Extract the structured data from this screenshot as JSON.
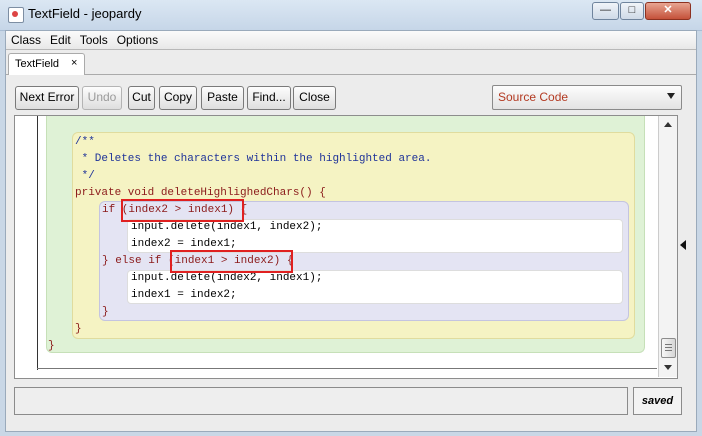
{
  "window": {
    "title": "TextField - jeopardy",
    "min_glyph": "—",
    "max_glyph": "□",
    "close_glyph": "✕"
  },
  "menu": {
    "items": [
      "Class",
      "Edit",
      "Tools",
      "Options"
    ]
  },
  "tabs": [
    {
      "label": "TextField",
      "close": "×"
    }
  ],
  "toolbar": {
    "buttons": [
      {
        "label": "Next Error",
        "enabled": true
      },
      {
        "label": "Undo",
        "enabled": false
      },
      {
        "label": "Cut",
        "enabled": true
      },
      {
        "label": "Copy",
        "enabled": true
      },
      {
        "label": "Paste",
        "enabled": true
      },
      {
        "label": "Find...",
        "enabled": true
      },
      {
        "label": "Close",
        "enabled": true
      }
    ],
    "view_select": "Source Code"
  },
  "code": {
    "lines": [
      "/**",
      " * Deletes the characters within the highlighted area.",
      " */",
      "private void deleteHighlighedChars() {",
      "if (index2 > index1) {",
      "input.delete(index1, index2);",
      "index2 = index1;",
      "} else if (index1 > index2) {",
      "input.delete(index2, index1);",
      "index1 = index2;",
      "}",
      "}",
      "}"
    ]
  },
  "status": {
    "message": "",
    "saved": "saved"
  },
  "colors": {
    "class_scope": "#dff2d6",
    "method_scope": "#f5f3c3",
    "if_scope": "#e4e4f3",
    "highlight_box": "#e02020"
  }
}
